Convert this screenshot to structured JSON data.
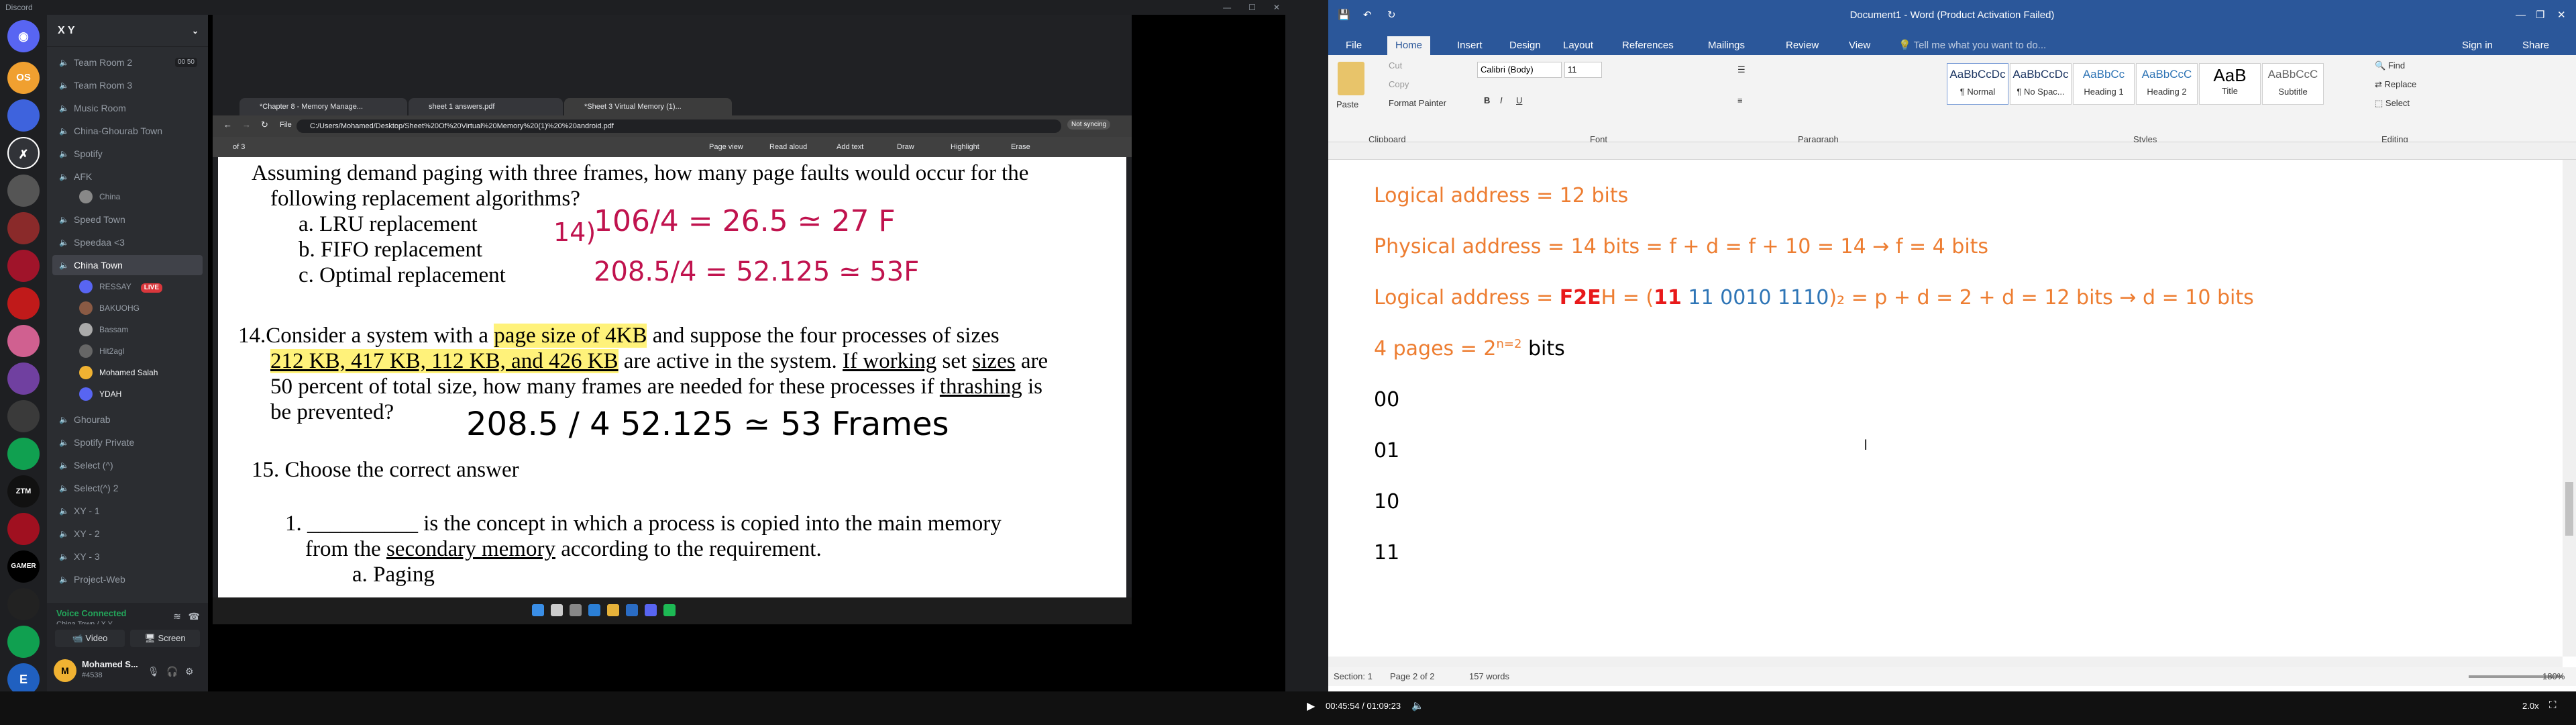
{
  "discord": {
    "app_title": "Discord",
    "server_name": "X Y",
    "channels": [
      {
        "name": "Team Room 2",
        "count": "00  50"
      },
      {
        "name": "Team Room 3"
      },
      {
        "name": "Music Room"
      },
      {
        "name": "China-Ghourab Town"
      },
      {
        "name": "Spotify"
      },
      {
        "name": "AFK"
      }
    ],
    "afk_user": "China",
    "channels2": [
      {
        "name": "Speed Town"
      },
      {
        "name": "Speedaa <3"
      },
      {
        "name": "China Town"
      }
    ],
    "voice_users": [
      {
        "name": "RESSAY",
        "live": "LIVE",
        "color": "#5865f2"
      },
      {
        "name": "BAKUOHG",
        "color": "#8a5a44"
      },
      {
        "name": "Bassam",
        "color": "#aaaaaa"
      },
      {
        "name": "Hit2agl",
        "color": "#666666"
      },
      {
        "name": "Mohamed Salah",
        "color": "#f0b232"
      },
      {
        "name": "YDAH",
        "color": "#5865f2"
      }
    ],
    "channels3": [
      {
        "name": "Ghourab"
      },
      {
        "name": "Spotify Private"
      },
      {
        "name": "Select (^)"
      },
      {
        "name": "Select(^) 2"
      },
      {
        "name": "XY - 1"
      },
      {
        "name": "XY - 2"
      },
      {
        "name": "XY - 3"
      },
      {
        "name": "Project-Web"
      }
    ],
    "voice_status": "Voice Connected",
    "voice_location": "China Town / X Y",
    "video_label": "Video",
    "screen_label": "Screen",
    "user_name": "Mohamed S...",
    "user_tag": "#4538",
    "live_badge": "LIVE",
    "guild_labels": [
      "OS",
      "",
      "",
      "",
      "",
      "",
      "ZTM",
      "",
      "GAMER",
      "",
      "",
      "E"
    ]
  },
  "browser": {
    "tabs": [
      "*Chapter 8 - Memory Manage...",
      "sheet 1 answers.pdf",
      "*Sheet 3 Virtual Memory (1)..."
    ],
    "address_label": "File",
    "url": "C:/Users/Mohamed/Desktop/Sheet%20Of%20Virtual%20Memory%20(1)%20%20android.pdf",
    "page_indicator": "of 3",
    "toolbar": [
      "Page view",
      "Read aloud",
      "Add text",
      "Draw",
      "Highlight",
      "Erase"
    ],
    "not_syncing": "Not syncing"
  },
  "pdf": {
    "q_intro1": "Assuming demand paging with three frames, how many page faults would occur for the",
    "q_intro2": "following replacement algorithms?",
    "opt_a": "a.   LRU replacement",
    "opt_b": "b.   FIFO replacement",
    "opt_c": "c.   Optimal replacement",
    "q14_num": "14.",
    "q14_l1a": "Consider a system with a ",
    "q14_l1b": "page size of 4KB",
    "q14_l1c": " and suppose the four processes of sizes",
    "q14_l2a": "212 KB, 417 KB, 112 KB, and 426 KB",
    "q14_l2b": " are active in the system. ",
    "q14_l2c": "If working",
    "q14_l2d": " set ",
    "q14_l2e": "sizes",
    "q14_l2f": " are",
    "q14_l3a": "50 percent of total size, how many frames are needed for these processes if ",
    "q14_l3b": "thrashing",
    "q14_l3c": " is",
    "q14_l4": "be prevented?",
    "q15": "15. Choose the correct answer",
    "q15_1a": "1. __________ is the concept in which a process is copied into the main memory",
    "q15_1b": "from the ",
    "q15_1c": "secondary memory",
    "q15_1d": " according to the requirement.",
    "q15_opt": "a.   Paging",
    "hw1": "14)",
    "hw2": "106/4  = 26.5 ≃ 27 F",
    "hw3": "208.5/4 = 52.125 ≃ 53F",
    "hw4": "208.5 / 4     52.125 ≃ 53 Frames"
  },
  "word": {
    "title": "Document1 - Word (Product Activation Failed)",
    "tabs": [
      "File",
      "Home",
      "Insert",
      "Design",
      "Layout",
      "References",
      "Mailings",
      "Review",
      "View"
    ],
    "tell_me": "Tell me what you want to do...",
    "sign_in": "Sign in",
    "share": "Share",
    "clipboard": {
      "paste": "Paste",
      "cut": "Cut",
      "copy": "Copy",
      "format_painter": "Format Painter",
      "label": "Clipboard"
    },
    "font": {
      "name": "Calibri (Body)",
      "size": "11",
      "label": "Font"
    },
    "paragraph_label": "Paragraph",
    "styles": [
      {
        "preview": "AaBbCcDc",
        "name": "¶ Normal"
      },
      {
        "preview": "AaBbCcDc",
        "name": "¶ No Spac..."
      },
      {
        "preview": "AaBbCc",
        "name": "Heading 1"
      },
      {
        "preview": "AaBbCcC",
        "name": "Heading 2"
      },
      {
        "preview": "AaB",
        "name": "Title"
      },
      {
        "preview": "AaBbCcC",
        "name": "Subtitle"
      }
    ],
    "styles_label": "Styles",
    "editing": {
      "find": "Find",
      "replace": "Replace",
      "select": "Select",
      "label": "Editing"
    },
    "lines": {
      "l1": "Logical address = 12 bits",
      "l2": "Physical address = 14 bits = f + d = f + 10 = 14 → f = 4 bits",
      "l3a": "Logical address = ",
      "l3b": "F2E",
      "l3c": "H = (",
      "l3d": "11",
      "l3e": " 11 0010 1110",
      "l3f": ")₂ = p + d = 2 + d = 12 bits → d = 10 bits",
      "l4a": "4 pages = 2",
      "l4b": "n=2",
      "l4c": " bits",
      "b1": "00",
      "b2": "01",
      "b3": "10",
      "b4": "11"
    },
    "status": {
      "section": "Section: 1",
      "page": "Page 2 of 2",
      "words": "157 words",
      "zoom": "180%"
    }
  },
  "player": {
    "time": "00:45:54 / 01:09:23",
    "speed": "2.0x"
  }
}
